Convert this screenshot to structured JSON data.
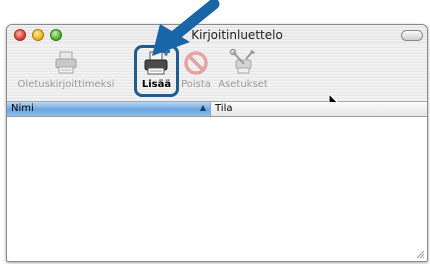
{
  "window": {
    "title": "Kirjoitinluettelo"
  },
  "toolbar": {
    "default_label": "Oletuskirjoittimeksi",
    "add_label": "Lisää",
    "delete_label": "Poista",
    "settings_label": "Asetukset"
  },
  "table": {
    "columns": [
      "Nimi",
      "Tila"
    ],
    "sort_indicator": "▲",
    "rows": []
  },
  "colors": {
    "highlight_border": "#1f5c8f",
    "arrow": "#1a64a8",
    "selected_column": "#6aa6e2"
  }
}
